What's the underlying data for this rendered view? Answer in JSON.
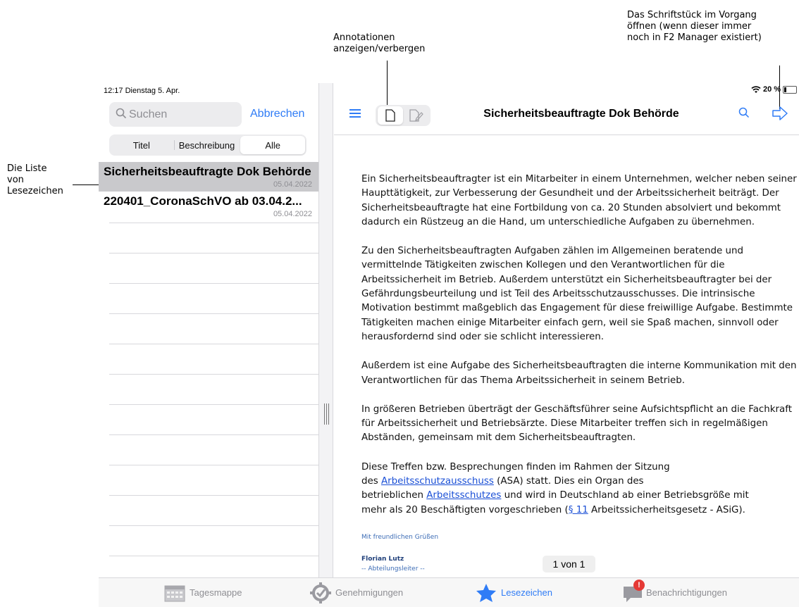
{
  "callouts": {
    "annotations": [
      "Annotationen",
      "anzeigen/verbergen"
    ],
    "open_doc": [
      "Das Schriftstück im Vorgang",
      "öffnen (wenn dieser immer",
      "noch in F2 Manager existiert)"
    ],
    "list": [
      "Die Liste",
      "von",
      "Lesezeichen"
    ]
  },
  "status": {
    "time_date": "12:17  Dienstag 5. Apr.",
    "battery": "20 %"
  },
  "search": {
    "placeholder": "Suchen",
    "cancel": "Abbrechen"
  },
  "segments": [
    {
      "label": "Titel",
      "active": false
    },
    {
      "label": "Beschreibung",
      "active": false
    },
    {
      "label": "Alle",
      "active": true
    }
  ],
  "bookmarks": [
    {
      "title": "Sicherheitsbeauftragte Dok Behörde",
      "date": "05.04.2022",
      "selected": true
    },
    {
      "title": "220401_CoronaSchVO ab 03.04.2...",
      "date": "05.04.2022",
      "selected": false
    }
  ],
  "toolbar": {
    "title": "Sicherheitsbeauftragte Dok Behörde"
  },
  "doc": {
    "p1": "Ein Sicherheitsbeauftragter ist ein Mitarbeiter in einem Unternehmen, welcher neben seiner Haupttätigkeit, zur Verbesserung der Gesundheit und der Arbeitssicherheit beiträgt. Der Sicherheitsbeauftragte hat eine Fortbildung von ca. 20 Stunden absolviert und bekommt dadurch ein Rüstzeug an die Hand, um unterschiedliche Aufgaben zu übernehmen.",
    "p2": "Zu den Sicherheitsbeauftragten Aufgaben zählen im Allgemeinen beratende und vermittelnde Tätigkeiten zwischen Kollegen und den Verantwortlichen für die Arbeitssicherheit im Betrieb. Außerdem unterstützt ein Sicherheitsbeauftragter bei der Gefährdungsbeurteilung und ist Teil des Arbeitsschutzausschusses. Die intrinsische Motivation bestimmt maßgeblich das Engagement für diese freiwillige Aufgabe. Bestimmte Tätigkeiten machen einige Mitarbeiter einfach gern, weil sie Spaß machen, sinnvoll oder herausfordernd sind oder sie schlicht interessieren.",
    "p3": "Außerdem ist eine Aufgabe des Sicherheitsbeauftragten die interne Kommunikation mit den Verantwortlichen für das Thema Arbeitssicherheit in seinem Betrieb.",
    "p4": "In größeren Betrieben überträgt der Geschäftsführer seine Aufsichtspflicht an die Fachkraft für Arbeitssicherheit und Betriebsärzte. Diese Mitarbeiter treffen sich in regelmäßigen Abständen, gemeinsam mit dem Sicherheitsbeauftragten.",
    "p5a": "Diese Treffen bzw. Besprechungen finden im Rahmen der Sitzung",
    "p5b": "des ",
    "p5_link1": "Arbeitsschutzausschuss",
    "p5c": " (ASA) statt. Dies ein Organ des",
    "p5d": "betrieblichen ",
    "p5_link2": "Arbeitsschutzes",
    "p5e": " und wird in Deutschland ab einer Betriebsgröße mit",
    "p5f": "mehr als 20 Beschäftigten vorgeschrieben (",
    "p5_link3": "§ 11",
    "p5g": " Arbeitssicherheitsgesetz - ASiG).",
    "greeting": "Mit freundlichen Grüßen",
    "sign_name": "Florian Lutz",
    "sign_role": "-- Abteilungsleiter --"
  },
  "pager": "1 von 1",
  "tabs": [
    {
      "label": "Tagesmappe",
      "icon": "calendar-icon"
    },
    {
      "label": "Genehmigungen",
      "icon": "check-gear-icon"
    },
    {
      "label": "Lesezeichen",
      "icon": "star-icon",
      "active": true
    },
    {
      "label": "Benachrichtigungen",
      "icon": "chat-bubble-icon",
      "badge": "!"
    }
  ],
  "colors": {
    "accent": "#2f7cf6",
    "badge": "#e53935",
    "selected_row": "#c9c9cc"
  }
}
